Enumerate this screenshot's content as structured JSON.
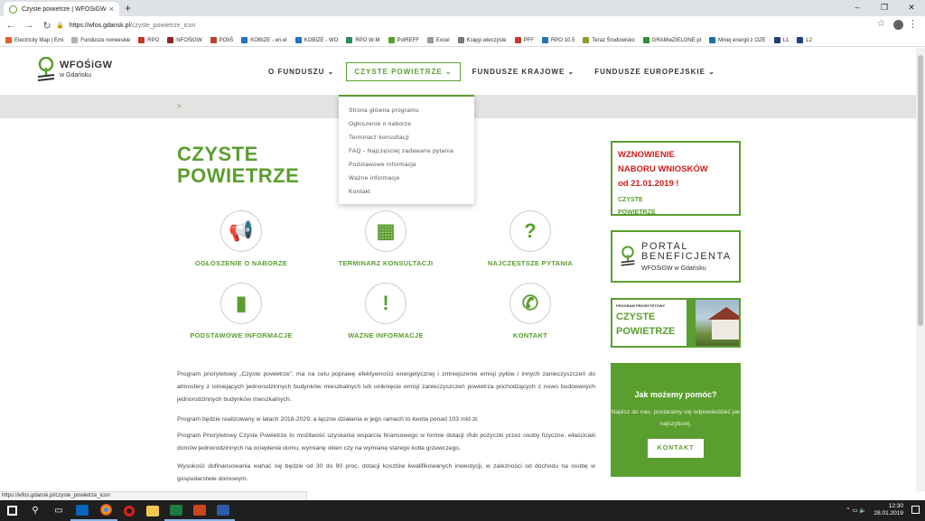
{
  "browser": {
    "tab_title": "Czyste powietrze | WFOŚiGW w G",
    "tab_close": "×",
    "new_tab": "+",
    "window_controls": [
      "–",
      "❐",
      "✕"
    ],
    "url_domain": "https://wfos.gdansk.pl",
    "url_path": "/czyste_powietrze_icon",
    "bookmarks": [
      {
        "label": "Electricity Map | Emi",
        "color": "#e25b2c"
      },
      {
        "label": "Fundusze norweskie",
        "color": "#b0b0b0"
      },
      {
        "label": "RPO",
        "color": "#c0392b"
      },
      {
        "label": "NFOŚiGW",
        "color": "#8b2b1c"
      },
      {
        "label": "POIiŚ",
        "color": "#b5462b"
      },
      {
        "label": "KOBIZE - en.el",
        "color": "#2a6fb8"
      },
      {
        "label": "KOBIZE - WO",
        "color": "#2a6fb8"
      },
      {
        "label": "RPO W-M",
        "color": "#2a8a5a"
      },
      {
        "label": "PolREFF",
        "color": "#5a9e2f"
      },
      {
        "label": "Excel",
        "color": "#999999"
      },
      {
        "label": "Księgi wieczyste",
        "color": "#777777"
      },
      {
        "label": "PFF",
        "color": "#c0392b"
      },
      {
        "label": "RPO 10.5",
        "color": "#2a6fb8"
      },
      {
        "label": "Teraz Środowisko",
        "color": "#8aa02a"
      },
      {
        "label": "GRAMwZIELONE.pl",
        "color": "#2d8f2d"
      },
      {
        "label": "Mniej energii z OZE",
        "color": "#1f6f9f"
      },
      {
        "label": "L1",
        "color": "#1f3f7f"
      },
      {
        "label": "L2",
        "color": "#1f3f7f"
      }
    ],
    "status_url": "https://wfos.gdansk.pl/czyste_powietrze_icon"
  },
  "site": {
    "logo_main": "WFOŚiGW",
    "logo_sub": "w Gdańsku",
    "nav": [
      {
        "label": "O FUNDUSZU ⌄",
        "active": false
      },
      {
        "label": "CZYSTE POWIETRZE ⌄",
        "active": true
      },
      {
        "label": "FUNDUSZE KRAJOWE ⌄",
        "active": false
      },
      {
        "label": "FUNDUSZE EUROPEJSKIE ⌄",
        "active": false
      }
    ],
    "breadcrumb": ">",
    "dropdown": [
      "Strona główna programu",
      "Ogłoszenie o naborze",
      "Terminarz konsultacji",
      "FAQ - Najczęściej zadawane pytania",
      "Podstawowe informacje",
      "Ważne informacje",
      "Kontakt"
    ],
    "title_line1": "CZYSTE",
    "title_line2": "POWIETRZE",
    "tiles": [
      {
        "icon": "megaphone-icon",
        "glyph": "📢",
        "label": "OGŁOSZENIE O NABORZE"
      },
      {
        "icon": "calendar-icon",
        "glyph": "▦",
        "label": "TERMINARZ KONSULTACJI"
      },
      {
        "icon": "question-icon",
        "glyph": "?",
        "label": "NAJCZĘSTSZE PYTANIA"
      },
      {
        "icon": "document-icon",
        "glyph": "▮",
        "label": "PODSTAWOWE INFORMACJE"
      },
      {
        "icon": "exclamation-icon",
        "glyph": "!",
        "label": "WAŻNE INFORMACJE"
      },
      {
        "icon": "phone-icon",
        "glyph": "✆",
        "label": "KONTAKT"
      }
    ],
    "paragraphs": [
      "Program priorytetowy „Czyste powietrze”, ma na celu poprawę efektywności energetycznej i zmniejszenie emisji pyłów i innych zanieczyszczeń do atmosfery z istniejących jednorodzinnych budynków mieszkalnych lub uniknięcie emisji zanieczyszczeń powietrza pochodzących z nowo budowanych jednorodzinnych budynków mieszkalnych.",
      "Program będzie realizowany w latach 2018-2029, a łączne działania w jego ramach to kwota ponad 103 mld zł.",
      "Program Priorytetowy Czyste Powietrze to możliwość uzyskania wsparcia finansowego w formie dotacji i/lub pożyczki przez osoby fizyczne, właścicieli domów jednorodzinnych na ocieplenie domu, wymianę okien czy na wymianę starego kotła grzewczego.",
      "Wysokość dofinansowania wahać się będzie od 30 do 90 proc. dotacji kosztów kwalifikowanych inwestycji, w zależności od dochodu na osobę w gospodarstwie domowym."
    ],
    "ad1_line1": "WZNOWIENIE",
    "ad1_line2": "NABORU WNIOSKÓW",
    "ad1_line3": "od 21.01.2019 !",
    "ad1_small1": "CZYSTE",
    "ad1_small2": "POWIETRZE",
    "ad2_title": "PORTAL BENEFICJENTA",
    "ad2_sub": "WFOŚiGW w Gdańsku",
    "ad3_small": "PROGRAM PRIORYTETOWY",
    "ad3_line1": "CZYSTE",
    "ad3_line2": "POWIETRZE",
    "help_title": "Jak możemy pomóc?",
    "help_text": "Napisz do nas, postaramy się odpowiedzieć jak najszybciej.",
    "help_button": "KONTAKT"
  },
  "taskbar": {
    "time": "12:30",
    "date": "28.01.2019",
    "tray_icons": "⌃ ▭ 🔈"
  },
  "colors": {
    "accent": "#5a9e2f",
    "alert_red": "#d21b1b"
  }
}
